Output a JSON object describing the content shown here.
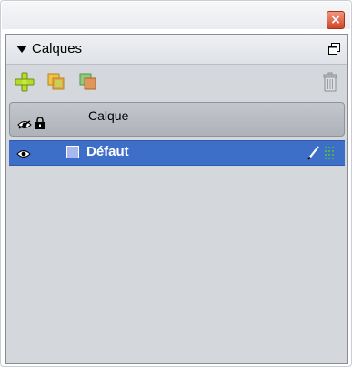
{
  "window": {
    "close_icon": "close-icon",
    "accent_close": "#d2452a"
  },
  "panel": {
    "title": "Calques",
    "collapse_icon": "triangle-down-icon",
    "menu_icon": "panel-menu-icon"
  },
  "toolbar": {
    "icons": [
      "add-layer-icon",
      "duplicate-layer-icon",
      "merge-layer-icon",
      "delete-layer-icon"
    ]
  },
  "columns": {
    "visibility_icon": "eye-icon",
    "lock_icon": "lock-icon",
    "name_label": "Calque"
  },
  "layers": [
    {
      "name": "Défaut",
      "selected": true,
      "visible": true,
      "swatch_color": "#a8b8ee",
      "icons": [
        "eye-icon",
        "pencil-icon",
        "grid-icon"
      ]
    }
  ],
  "colors": {
    "selection": "#3d6fc8",
    "panel_background": "#d4d7dc"
  }
}
